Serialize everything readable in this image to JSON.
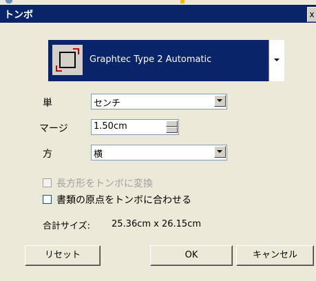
{
  "window": {
    "title": "トンボ",
    "close_glyph": "x"
  },
  "device": {
    "name": "Graphtec Type 2 Automatic",
    "icon": "crop-mark-icon"
  },
  "fields": {
    "unit": {
      "label": "単",
      "value": "センチ"
    },
    "margin": {
      "label": "マージ",
      "value": "1.50cm"
    },
    "direction": {
      "label": "方",
      "value": "横"
    }
  },
  "checkboxes": {
    "convert_rect": {
      "label": "長方形をトンボに変換",
      "checked": false,
      "disabled": true
    },
    "match_origin": {
      "label": "書類の原点をトンボに合わせる",
      "checked": false,
      "disabled": false
    }
  },
  "total_size": {
    "label": "合計サイズ:",
    "value": "25.36cm x 26.15cm"
  },
  "buttons": {
    "reset": "リセット",
    "ok": "OK",
    "cancel": "キャンセル"
  },
  "colors": {
    "titlebar": "#0a246a",
    "face": "#ece9d8",
    "crop_mark": "#cc0000"
  }
}
